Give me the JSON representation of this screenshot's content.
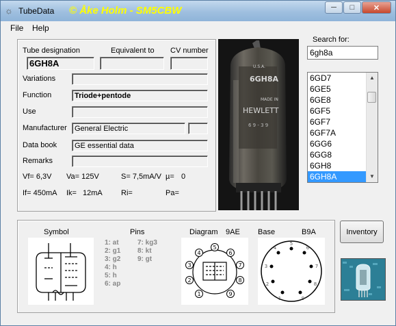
{
  "window": {
    "title": "TubeData",
    "banner": "© Åke Holm - SM5CBW",
    "minimize_glyph": "─",
    "maximize_glyph": "□",
    "close_glyph": "✕"
  },
  "menu": {
    "file": "File",
    "help": "Help"
  },
  "details": {
    "tube_designation_label": "Tube designation",
    "tube_designation": "6GH8A",
    "equivalent_to_label": "Equivalent to",
    "equivalent_to": "",
    "cv_number_label": "CV number",
    "cv_number": "",
    "variations_label": "Variations",
    "variations": "",
    "function_label": "Function",
    "function": "Triode+pentode",
    "use_label": "Use",
    "use": "",
    "manufacturer_label": "Manufacturer",
    "manufacturer": "General Electric",
    "manufacturer_extra": "",
    "data_book_label": "Data book",
    "data_book": "GE essential data",
    "remarks_label": "Remarks",
    "remarks": "",
    "vf": "Vf= 6,3V",
    "va": "Va= 125V",
    "s": "S= 7,5mA/V",
    "mu": "µ=",
    "mu_value": "0",
    "if": "If= 450mA",
    "ik": "Ik=",
    "ik_value": "12mA",
    "ri": "Ri=",
    "pa": "Pa="
  },
  "photo": {
    "print_line1": "U.S.A.",
    "print_line2": "6GH8A",
    "print_line3": "MADE IN",
    "print_line4": "HEWLETT",
    "print_line5": "6 9 - 3 9"
  },
  "search": {
    "label": "Search for:",
    "value": "6gh8a"
  },
  "tube_list": {
    "items": [
      "6GD7",
      "6GE5",
      "6GE8",
      "6GF5",
      "6GF7",
      "6GF7A",
      "6GG6",
      "6GG8",
      "6GH8",
      "6GH8A"
    ],
    "selected": "6GH8A"
  },
  "inventory_button": "Inventory",
  "bottom": {
    "symbol_label": "Symbol",
    "pins_label": "Pins",
    "diagram_label": "Diagram",
    "diagram_code": "9AE",
    "base_label": "Base",
    "base_code": "B9A",
    "pins_col1": [
      "1: at",
      "2: g1",
      "3: g2",
      "4: h",
      "5: h",
      "6: ap"
    ],
    "pins_col2": [
      "7: kg3",
      "8: kt",
      "9: gt"
    ]
  },
  "colors": {
    "banner": "#ffff00",
    "titlebar": "#9fbfdf",
    "selection": "#3399ff",
    "background": "#f0f0f0"
  }
}
